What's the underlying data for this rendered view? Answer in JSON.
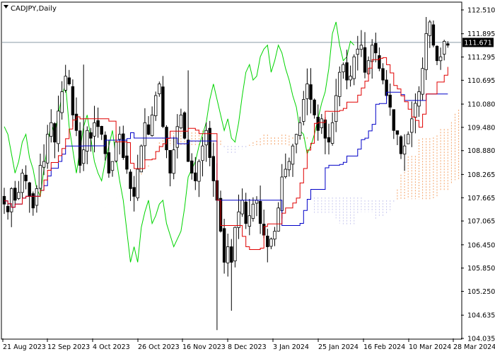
{
  "header": {
    "symbol": "CADJPY,Daily",
    "current_price": "111.671"
  },
  "colors": {
    "candles": "#000000",
    "tenkan": "#e00000",
    "kijun": "#0000c8",
    "chikou": "#00d400",
    "kumo_bull": "#f4a46a",
    "kumo_bear": "#c8c8ee",
    "price_line": "#8a9aa8",
    "price_tag_bg": "#000000",
    "price_tag_fg": "#ffffff"
  },
  "icons": {
    "menu": "triangle-down-icon"
  },
  "chart_data": {
    "type": "candlestick",
    "title": "CADJPY,Daily",
    "ylim": [
      104.0,
      112.9
    ],
    "y_ticks": [
      "112.510",
      "111.895",
      "111.295",
      "110.695",
      "110.080",
      "109.480",
      "108.880",
      "108.265",
      "107.665",
      "107.065",
      "106.450",
      "105.850",
      "105.250",
      "104.635",
      "104.035"
    ],
    "x_ticks": [
      "21 Aug 2023",
      "12 Sep 2023",
      "4 Oct 2023",
      "26 Oct 2023",
      "16 Nov 2023",
      "8 Dec 2023",
      "3 Jan 2024",
      "25 Jan 2024",
      "16 Feb 2024",
      "10 Mar 2024",
      "28 Mar 2024"
    ],
    "current_price": 111.671,
    "indicator": "Ichimoku Kinko Hyo",
    "closes": [
      107.5,
      107.3,
      107.9,
      107.6,
      107.8,
      108.3,
      108.1,
      107.7,
      107.4,
      107.9,
      108.5,
      108.6,
      109.3,
      109.6,
      109.1,
      109.9,
      110.4,
      110.8,
      110.6,
      109.8,
      109.4,
      108.5,
      108.9,
      109.4,
      109.2,
      109.6,
      109.5,
      109.3,
      108.8,
      108.3,
      108.6,
      109.1,
      109.3,
      108.7,
      108.4,
      107.9,
      107.7,
      108.4,
      109.0,
      109.6,
      109.3,
      109.8,
      110.3,
      110.6,
      109.5,
      108.9,
      108.3,
      108.9,
      109.5,
      109.8,
      109.2,
      108.6,
      108.3,
      108.1,
      108.6,
      109.0,
      109.4,
      108.7,
      108.1,
      107.6,
      106.8,
      106.0,
      106.4,
      106.0,
      106.9,
      107.3,
      107.6,
      107.0,
      107.2,
      107.5,
      107.6,
      107.0,
      106.7,
      106.4,
      106.6,
      106.8,
      107.4,
      108.2,
      108.4,
      108.6,
      109.0,
      109.3,
      109.6,
      110.2,
      110.6,
      110.2,
      109.8,
      109.4,
      109.7,
      109.2,
      109.1,
      109.6,
      110.3,
      110.9,
      111.1,
      110.7,
      110.8,
      111.3,
      111.5,
      111.6,
      110.9,
      111.2,
      111.6,
      111.4,
      111.0,
      110.7,
      110.3,
      110.0,
      109.4,
      109.3,
      108.8,
      109.0,
      109.3,
      109.7,
      110.1,
      110.4,
      111.0,
      111.9,
      112.2,
      111.6,
      111.2,
      111.3,
      111.7,
      111.6
    ]
  }
}
